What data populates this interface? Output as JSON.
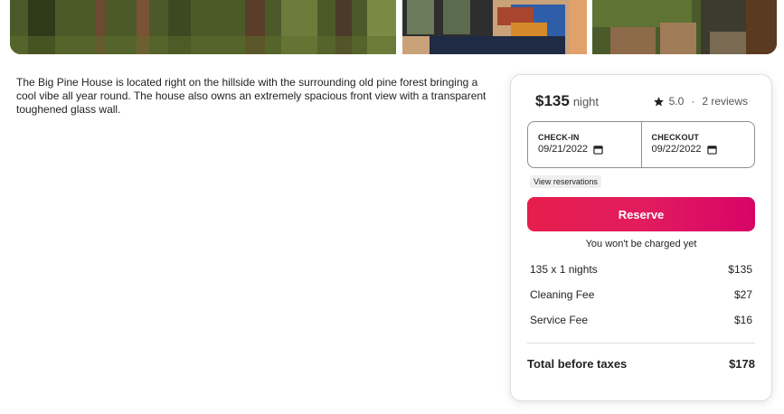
{
  "photos": [
    {
      "alt": "forest-pines",
      "icon": "photo-forest"
    },
    {
      "alt": "living-room-blue-sofa",
      "icon": "photo-interior"
    },
    {
      "alt": "rocky-hillside",
      "icon": "photo-rocks"
    }
  ],
  "description": "The Big Pine House is located right on the hillside with the surrounding old pine forest bringing a cool vibe all year round. The house also owns an extremely spacious front view with a transparent toughened glass wall.",
  "booking": {
    "price": "$135",
    "per": "night",
    "rating": "5.0",
    "separator": "·",
    "reviews": "2 reviews",
    "checkin_label": "CHECK-IN",
    "checkin_value": "09/21/2022",
    "checkout_label": "CHECKOUT",
    "checkout_value": "09/22/2022",
    "view_reservations": "View reservations",
    "reserve": "Reserve",
    "no_charge": "You won't be charged yet",
    "fees": [
      {
        "label": "135 x 1 nights",
        "amount": "$135"
      },
      {
        "label": "Cleaning Fee",
        "amount": "$27"
      },
      {
        "label": "Service Fee",
        "amount": "$16"
      }
    ],
    "total_label": "Total before taxes",
    "total_amount": "$178",
    "accent_color": "#e31c5f",
    "star_icon": "star-icon",
    "calendar_icon": "calendar-icon"
  }
}
